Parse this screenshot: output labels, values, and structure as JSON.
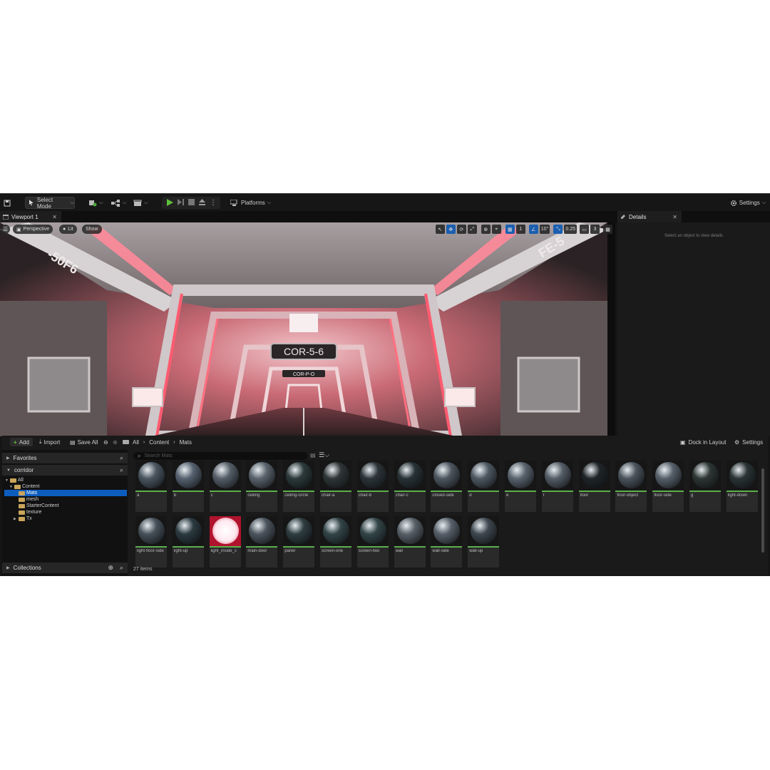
{
  "toolbar": {
    "select_mode": "Select Mode",
    "platforms": "Platforms",
    "settings": "Settings"
  },
  "tabs": {
    "viewport": "Viewport 1",
    "details": "Details"
  },
  "viewport": {
    "perspective": "Perspective",
    "lit": "Lit",
    "show": "Show",
    "grid_value": "1",
    "rotate_value": "10°",
    "scale_value": "0.25",
    "camera_value": "3",
    "scene_text": {
      "left_wall": "-50F6",
      "right_wall": "FE-5",
      "sign_main": "COR-5-6",
      "sign_far": "COR-P-O"
    }
  },
  "details": {
    "hint": "Select an object to view details"
  },
  "content_browser": {
    "add": "Add",
    "import": "Import",
    "save_all": "Save All",
    "breadcrumb": [
      "All",
      "Content",
      "Mats"
    ],
    "dock_in_layout": "Dock in Layout",
    "settings": "Settings",
    "search_placeholder": "Search Mats",
    "favorites": "Favorites",
    "project": "corridor",
    "collections": "Collections",
    "tree": [
      "All",
      "Content",
      "Mats",
      "mesh",
      "StarterContent",
      "texture",
      "Tx"
    ],
    "items_count": "27 items",
    "assets": [
      {
        "name": "a",
        "color": "#4a5560"
      },
      {
        "name": "b",
        "color": "#566270"
      },
      {
        "name": "c",
        "color": "#555e68"
      },
      {
        "name": "ceiling",
        "color": "#5a636d"
      },
      {
        "name": "ceiling-circle",
        "color": "#2c3a3a"
      },
      {
        "name": "chair-a",
        "color": "#2f3637"
      },
      {
        "name": "chair-b",
        "color": "#2b3438"
      },
      {
        "name": "chair-c",
        "color": "#273235"
      },
      {
        "name": "closed-side",
        "color": "#4d5660"
      },
      {
        "name": "d",
        "color": "#4e5862"
      },
      {
        "name": "e",
        "color": "#59636e"
      },
      {
        "name": "f",
        "color": "#545d66"
      },
      {
        "name": "floor",
        "color": "#1f2527"
      },
      {
        "name": "floor-object",
        "color": "#4a535c"
      },
      {
        "name": "floor-side",
        "color": "#56606a"
      },
      {
        "name": "g",
        "color": "#2d3634"
      },
      {
        "name": "light-down",
        "color": "#2a3334"
      },
      {
        "name": "light-floor-side",
        "color": "#47515a"
      },
      {
        "name": "light-up",
        "color": "#2b3a40"
      },
      {
        "name": "light_inside_c",
        "color": "#f4e6ec"
      },
      {
        "name": "main-door",
        "color": "#4c555e"
      },
      {
        "name": "panel",
        "color": "#2e3d40"
      },
      {
        "name": "screen-one",
        "color": "#334548"
      },
      {
        "name": "screen-two",
        "color": "#334548"
      },
      {
        "name": "wall",
        "color": "#586068"
      },
      {
        "name": "wall-side",
        "color": "#57606a"
      },
      {
        "name": "wall-up",
        "color": "#3e474f"
      }
    ]
  }
}
